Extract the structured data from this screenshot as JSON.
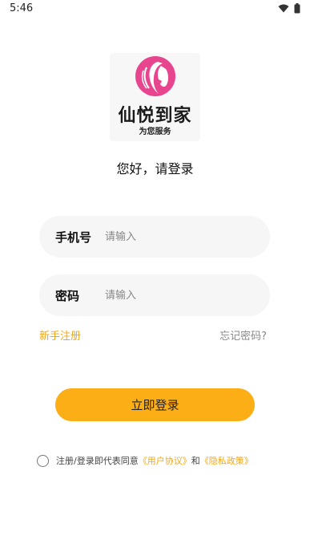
{
  "status_bar": {
    "time": "5:46"
  },
  "brand": {
    "name": "仙悦到家",
    "slogan": "为您服务",
    "accent": "#e8458f"
  },
  "greeting": "您好，请登录",
  "phone_field": {
    "label": "手机号",
    "placeholder": "请输入"
  },
  "password_field": {
    "label": "密码",
    "placeholder": "请输入"
  },
  "links": {
    "register": "新手注册",
    "forgot_password": "忘记密码?"
  },
  "login_button": "立即登录",
  "agreement": {
    "prefix": "注册/登录即代表同意",
    "user_agreement": "《用户协议》",
    "conjunction": "和",
    "privacy_policy": "《隐私政策》",
    "checked": false
  },
  "colors": {
    "primary": "#fcae17",
    "link": "#f2a716",
    "field_bg": "#f6f6f6"
  }
}
